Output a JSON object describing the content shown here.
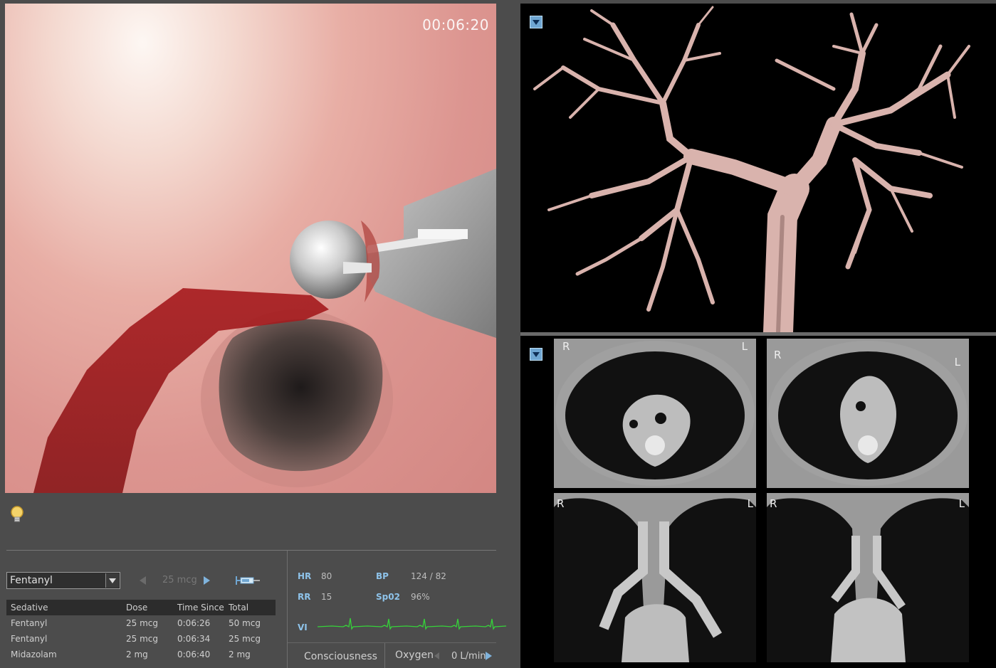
{
  "endoscope": {
    "timer": "00:06:20"
  },
  "hint": {
    "icon": "lightbulb-icon"
  },
  "sedation": {
    "selected_drug": "Fentanyl",
    "dose_step": "25 mcg",
    "table": {
      "headers": [
        "Sedative",
        "Dose",
        "Time Since",
        "Total"
      ],
      "rows": [
        [
          "Fentanyl",
          "25 mcg",
          "0:06:26",
          "50 mcg"
        ],
        [
          "Fentanyl",
          "25 mcg",
          "0:06:34",
          "25 mcg"
        ],
        [
          "Midazolam",
          "2 mg",
          "0:06:40",
          "2 mg"
        ]
      ]
    }
  },
  "vitals": {
    "hr_label": "HR",
    "hr_value": "80",
    "bp_label": "BP",
    "bp_value": "124 / 82",
    "rr_label": "RR",
    "rr_value": "15",
    "spo2_label": "Sp02",
    "spo2_value": "96%",
    "vi_label": "VI",
    "ecg_color": "#36d23a"
  },
  "bottom_bar": {
    "consciousness_label": "Consciousness",
    "oxygen_label": "Oxygen",
    "oxygen_value": "0 L/min"
  },
  "ct_views": {
    "r": "R",
    "l": "L"
  },
  "colors": {
    "accent_blue": "#6fa6d2",
    "vital_label": "#8ec3ea",
    "airway": "#d9b3ad"
  }
}
